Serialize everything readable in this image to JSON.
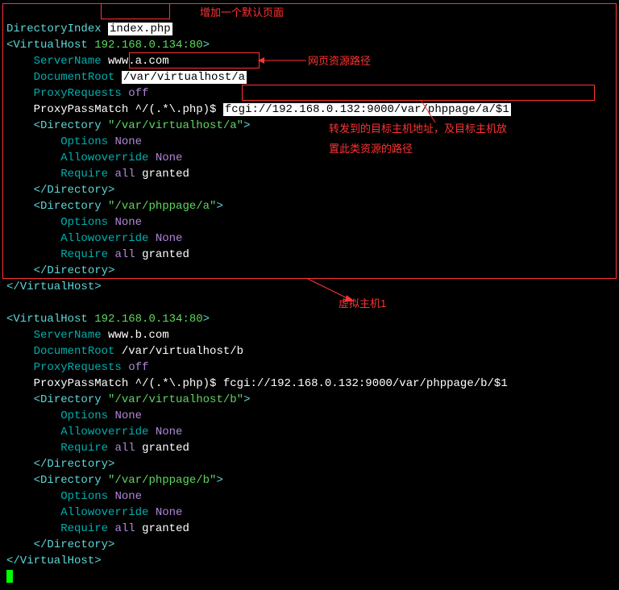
{
  "line1": {
    "a": "DirectoryIndex",
    "b": "index.php"
  },
  "vh1": {
    "open_a": "<VirtualHost",
    "addr": "192.168.0.134:80",
    "open_b": ">",
    "sn_k": "ServerName",
    "sn_v": "www.a.com",
    "dr_k": "DocumentRoot",
    "dr_v": "/var/virtualhost/a",
    "pr_k": "ProxyRequests",
    "pr_v": "off",
    "pm_k": "ProxyPassMatch",
    "pm_pat": "^/(.*\\.php)$",
    "pm_tgt": "fcgi://192.168.0.132:9000/var/phppage/a/$1",
    "d1_open_a": "<Directory",
    "d1_path": "\"/var/virtualhost/a\"",
    "d1_open_b": ">",
    "opt_k": "Options",
    "opt_v": "None",
    "ao_k": "Allowoverride",
    "ao_v": "None",
    "req_k": "Require",
    "req_a": "all",
    "req_b": "granted",
    "d_close": "</Directory>",
    "d2_open_a": "<Directory",
    "d2_path": "\"/var/phppage/a\"",
    "d2_open_b": ">",
    "close": "</VirtualHost>"
  },
  "vh2": {
    "open_a": "<VirtualHost",
    "addr": "192.168.0.134:80",
    "open_b": ">",
    "sn_k": "ServerName",
    "sn_v": "www.b.com",
    "dr_k": "DocumentRoot",
    "dr_v": "/var/virtualhost/b",
    "pr_k": "ProxyRequests",
    "pr_v": "off",
    "pm_k": "ProxyPassMatch",
    "pm_pat": "^/(.*\\.php)$",
    "pm_tgt": "fcgi://192.168.0.132:9000/var/phppage/b/$1",
    "d1_open_a": "<Directory",
    "d1_path": "\"/var/virtualhost/b\"",
    "d1_open_b": ">",
    "opt_k": "Options",
    "opt_v": "None",
    "ao_k": "Allowoverride",
    "ao_v": "None",
    "req_k": "Require",
    "req_a": "all",
    "req_b": "granted",
    "d_close": "</Directory>",
    "d2_open_a": "<Directory",
    "d2_path": "\"/var/phppage/b\"",
    "d2_open_b": ">",
    "close": "</VirtualHost>"
  },
  "ann": {
    "a1": "增加一个默认页面",
    "a2": "网页资源路径",
    "a3": "转发到的目标主机地址，及目标主机放",
    "a3b": "置此类资源的路径",
    "a4": "虚拟主机1"
  }
}
